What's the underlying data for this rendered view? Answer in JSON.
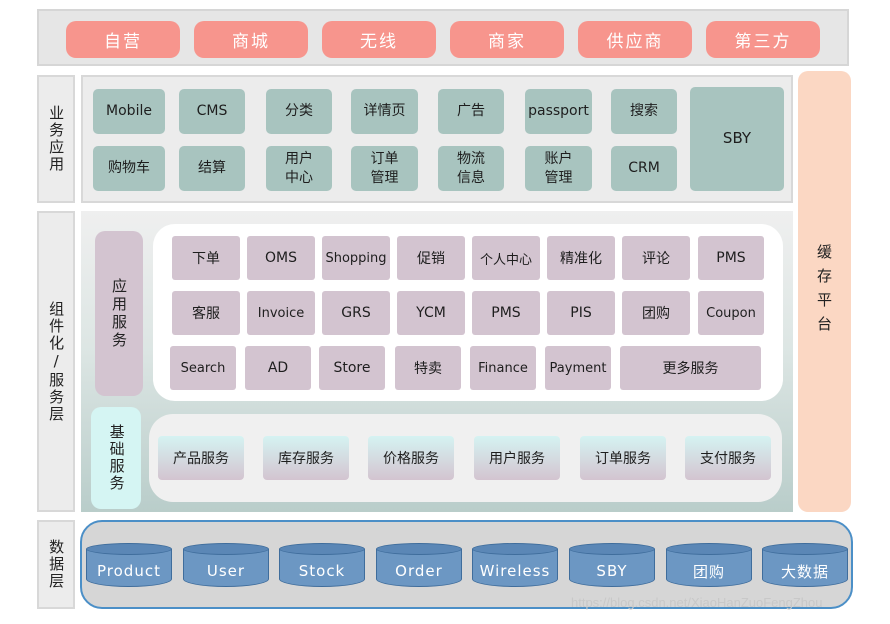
{
  "channels": [
    "自营",
    "商城",
    "无线",
    "商家",
    "供应商",
    "第三方"
  ],
  "layer_labels": {
    "business": "业务应用",
    "service": "组件化/服务层",
    "data": "数据层"
  },
  "business_apps": {
    "row1": [
      "Mobile",
      "CMS",
      "分类",
      "详情页",
      "广告",
      "passport",
      "搜索"
    ],
    "row2": [
      "购物车",
      "结算",
      "用户中心",
      "订单管理",
      "物流信息",
      "账户管理",
      "CRM"
    ],
    "big": "SBY"
  },
  "cache_platform": "缓存平台",
  "app_services": {
    "label": "应用服务",
    "row1": [
      "下单",
      "OMS",
      "Shopping",
      "促销",
      "个人中心",
      "精准化",
      "评论",
      "PMS"
    ],
    "row2": [
      "客服",
      "Invoice",
      "GRS",
      "YCM",
      "PMS",
      "PIS",
      "团购",
      "Coupon"
    ],
    "row3": [
      "Search",
      "AD",
      "Store",
      "特卖",
      "Finance",
      "Payment",
      "更多服务"
    ]
  },
  "base_services": {
    "label": "基础服务",
    "items": [
      "产品服务",
      "库存服务",
      "价格服务",
      "用户服务",
      "订单服务",
      "支付服务"
    ]
  },
  "databases": [
    "Product",
    "User",
    "Stock",
    "Order",
    "Wireless",
    "SBY",
    "团购",
    "大数据"
  ],
  "watermark": "https://blog.csdn.net/XiaoHanZuoFengZhou"
}
